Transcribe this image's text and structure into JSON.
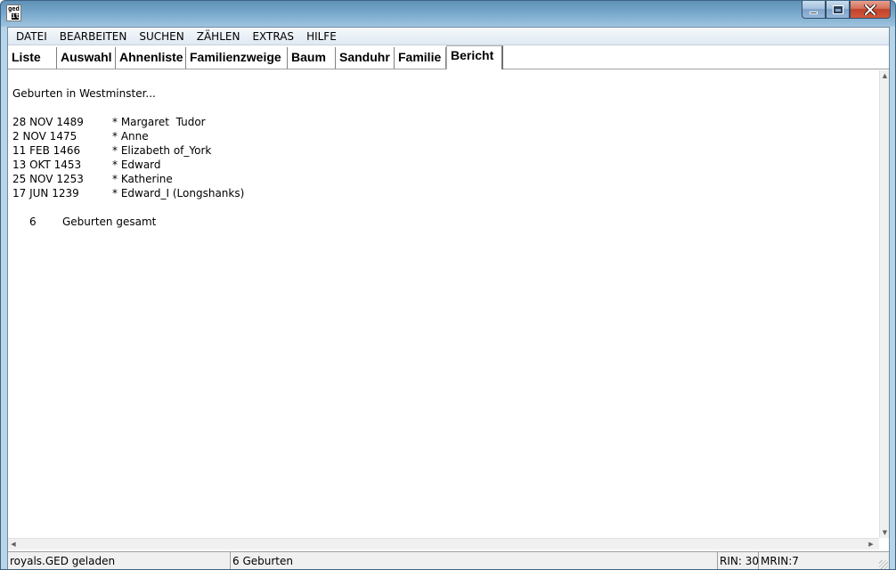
{
  "window": {
    "icon_text_top": "ged",
    "icon_text_bottom": "it!"
  },
  "menu": [
    "DATEI",
    "BEARBEITEN",
    "SUCHEN",
    "ZÄHLEN",
    "EXTRAS",
    "HILFE"
  ],
  "tabs": [
    {
      "label": "Liste",
      "active": false
    },
    {
      "label": "Auswahl",
      "active": false
    },
    {
      "label": "Ahnenliste",
      "active": false
    },
    {
      "label": "Familienzweige",
      "active": false
    },
    {
      "label": "Baum",
      "active": false
    },
    {
      "label": "Sanduhr",
      "active": false
    },
    {
      "label": "Familie",
      "active": false
    },
    {
      "label": "Bericht",
      "active": true
    }
  ],
  "report": {
    "heading": "Geburten in Westminster...",
    "rows": [
      {
        "date": "28 NOV 1489",
        "name": "* Margaret  Tudor"
      },
      {
        "date": "2 NOV 1475",
        "name": "* Anne"
      },
      {
        "date": "11 FEB 1466",
        "name": "* Elizabeth of_York"
      },
      {
        "date": "13 OKT 1453",
        "name": "* Edward"
      },
      {
        "date": "25 NOV 1253",
        "name": "* Katherine"
      },
      {
        "date": "17 JUN 1239",
        "name": "* Edward_I (Longshanks)"
      }
    ],
    "total_count": "6",
    "total_label": "Geburten gesamt"
  },
  "status": {
    "file": "royals.GED geladen",
    "summary": "6 Geburten",
    "rin": "RIN: 30",
    "mrin": "MRIN:7"
  }
}
